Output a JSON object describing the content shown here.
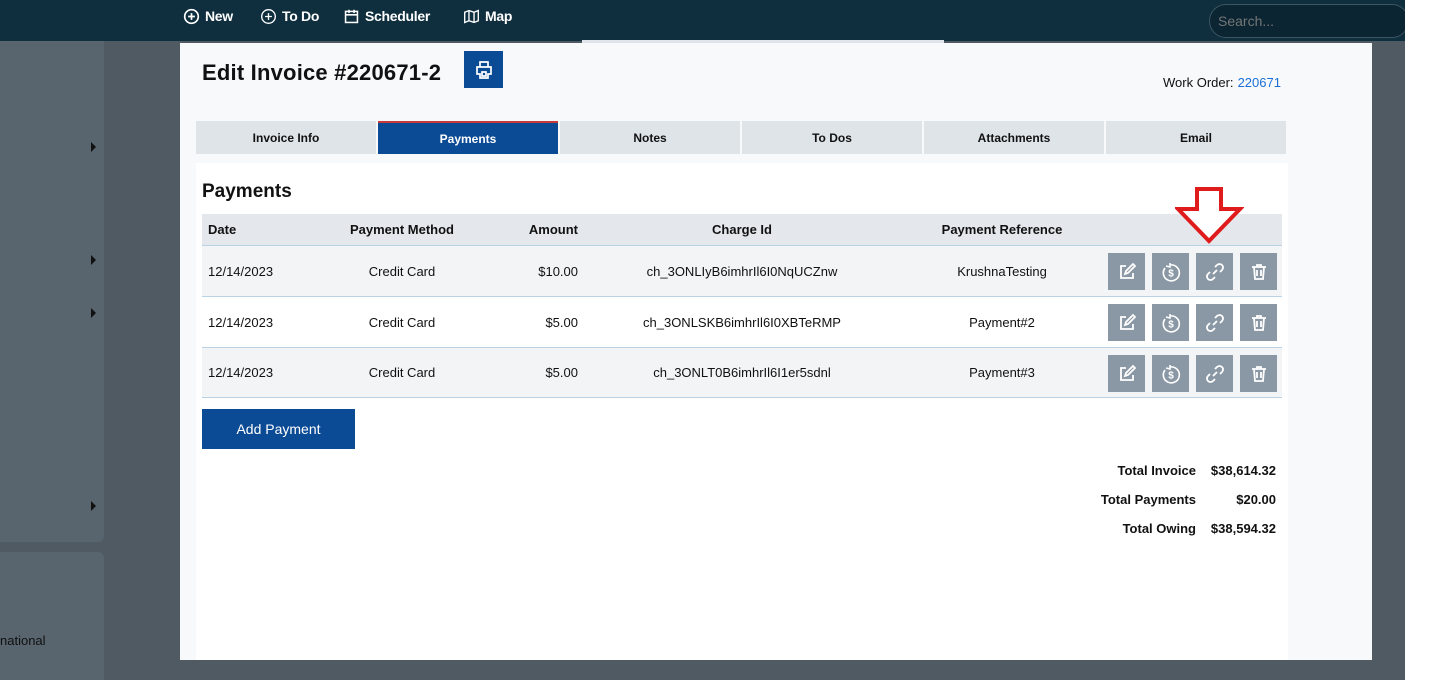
{
  "nav": {
    "new_label": "New",
    "todo_label": "To Do",
    "scheduler_label": "Scheduler",
    "map_label": "Map",
    "search_placeholder": "Search..."
  },
  "sidebar": {
    "partial_text": "national"
  },
  "modal": {
    "title": "Edit Invoice #220671-2",
    "work_order_label": "Work Order:",
    "work_order_value": "220671",
    "tabs": [
      {
        "label": "Invoice Info",
        "active": false
      },
      {
        "label": "Payments",
        "active": true
      },
      {
        "label": "Notes",
        "active": false
      },
      {
        "label": "To Dos",
        "active": false
      },
      {
        "label": "Attachments",
        "active": false
      },
      {
        "label": "Email",
        "active": false
      }
    ],
    "section_title": "Payments",
    "columns": {
      "date": "Date",
      "method": "Payment Method",
      "amount": "Amount",
      "charge": "Charge Id",
      "reference": "Payment Reference"
    },
    "rows": [
      {
        "date": "12/14/2023",
        "method": "Credit Card",
        "amount": "$10.00",
        "charge": "ch_3ONLIyB6imhrIl6I0NqUCZnw",
        "reference": "KrushnaTesting"
      },
      {
        "date": "12/14/2023",
        "method": "Credit Card",
        "amount": "$5.00",
        "charge": "ch_3ONLSKB6imhrIl6I0XBTeRMP",
        "reference": "Payment#2"
      },
      {
        "date": "12/14/2023",
        "method": "Credit Card",
        "amount": "$5.00",
        "charge": "ch_3ONLT0B6imhrIl6I1er5sdnl",
        "reference": "Payment#3"
      }
    ],
    "add_payment_label": "Add Payment",
    "totals": {
      "invoice_label": "Total Invoice",
      "invoice_value": "$38,614.32",
      "payments_label": "Total Payments",
      "payments_value": "$20.00",
      "owing_label": "Total Owing",
      "owing_value": "$38,594.32"
    }
  },
  "colors": {
    "nav_bg": "#0f2e3e",
    "primary": "#0b4a94",
    "action_button": "#8a98a5",
    "annotation_arrow": "#e01b1b",
    "link": "#1a6fd6"
  },
  "icons": [
    "plus-circle-icon",
    "calendar-icon",
    "map-icon",
    "printer-icon",
    "edit-icon",
    "refund-icon",
    "link-icon",
    "trash-icon"
  ]
}
